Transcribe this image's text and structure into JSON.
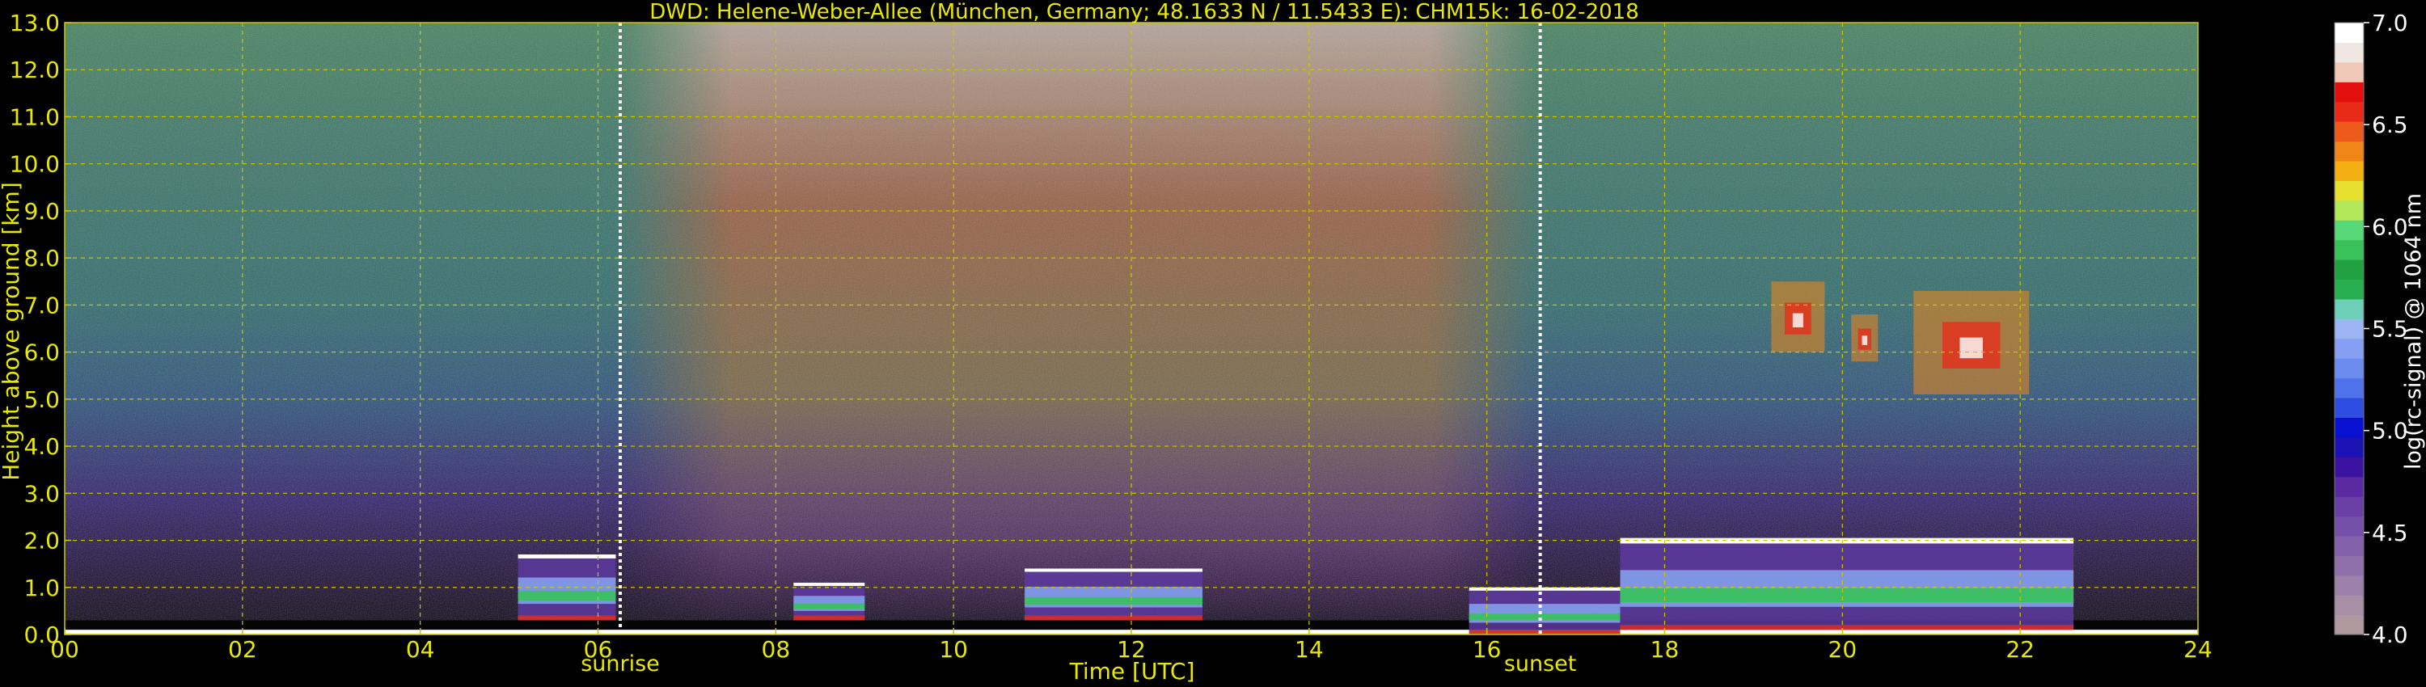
{
  "chart_data": {
    "type": "heatmap",
    "title": "DWD: Helene-Weber-Allee (München, Germany; 48.1633 N / 11.5433 E):    CHM15k: 16-02-2018",
    "xlabel": "Time [UTC]",
    "ylabel": "Height above ground [km]",
    "xlim": [
      0,
      24
    ],
    "ylim": [
      0,
      13
    ],
    "x_ticks": [
      "00",
      "02",
      "04",
      "06",
      "08",
      "10",
      "12",
      "14",
      "16",
      "18",
      "20",
      "22",
      "24"
    ],
    "y_ticks": [
      "0.0",
      "1.0",
      "2.0",
      "3.0",
      "4.0",
      "5.0",
      "6.0",
      "7.0",
      "8.0",
      "9.0",
      "10.0",
      "11.0",
      "12.0",
      "13.0"
    ],
    "grid": true,
    "colorbar": {
      "label": "log(rc-signal) @ 1064 nm",
      "range": [
        4.0,
        7.0
      ],
      "ticks": [
        "4.0",
        "4.5",
        "5.0",
        "5.5",
        "6.0",
        "6.5",
        "7.0"
      ],
      "colors": [
        "#b09aa0",
        "#a78fa6",
        "#9b81a9",
        "#8f70aa",
        "#8462ab",
        "#7450a8",
        "#6a3fa6",
        "#5c2aa0",
        "#3a14a0",
        "#1c12b4",
        "#0a10cf",
        "#2d4ee0",
        "#4f72ea",
        "#6b8bef",
        "#869ff2",
        "#9db4f5",
        "#6ed0b8",
        "#27ae4e",
        "#20a040",
        "#39c25a",
        "#57d879",
        "#b2e85a",
        "#e8e030",
        "#f4b012",
        "#f08618",
        "#ee5a1c",
        "#e82a18",
        "#e30e0e",
        "#f0c8b8",
        "#f0e6e2",
        "#ffffff"
      ]
    },
    "annotations": [
      {
        "text": "sunrise",
        "x": 6.25
      },
      {
        "text": "sunset",
        "x": 16.6
      }
    ],
    "cloud_layers": [
      {
        "start": 5.1,
        "end": 6.2,
        "base": 0.3,
        "top": 1.7
      },
      {
        "start": 8.2,
        "end": 9.0,
        "base": 0.3,
        "top": 1.1
      },
      {
        "start": 10.8,
        "end": 12.8,
        "base": 0.3,
        "top": 1.4
      },
      {
        "start": 15.8,
        "end": 17.5,
        "base": 0.0,
        "top": 1.0
      },
      {
        "start": 17.5,
        "end": 22.6,
        "base": 0.1,
        "top": 2.05
      }
    ],
    "cirrus": [
      {
        "start": 19.2,
        "end": 19.8,
        "base": 6.0,
        "top": 7.5
      },
      {
        "start": 20.1,
        "end": 20.4,
        "base": 5.8,
        "top": 6.8
      },
      {
        "start": 20.8,
        "end": 22.1,
        "base": 5.1,
        "top": 7.3
      }
    ]
  }
}
